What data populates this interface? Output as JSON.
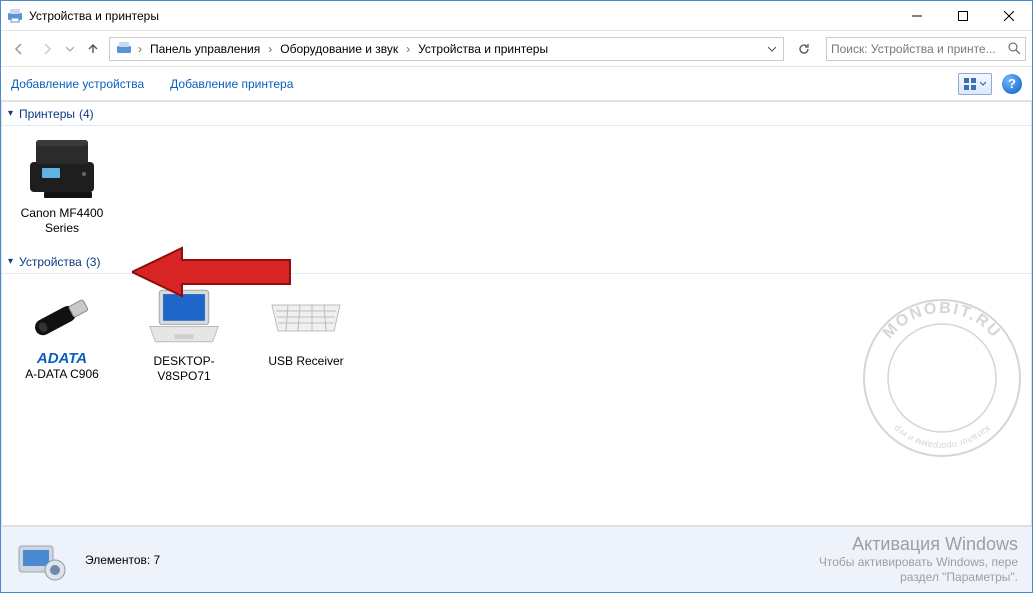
{
  "window": {
    "title": "Устройства и принтеры"
  },
  "nav": {
    "crumbs": [
      "Панель управления",
      "Оборудование и звук",
      "Устройства и принтеры"
    ]
  },
  "search": {
    "placeholder": "Поиск: Устройства и принте..."
  },
  "commands": {
    "add_device": "Добавление устройства",
    "add_printer": "Добавление принтера"
  },
  "groups": [
    {
      "name": "Принтеры",
      "count": "(4)",
      "items": [
        {
          "label": "Canon MF4400 Series",
          "icon": "printer"
        }
      ]
    },
    {
      "name": "Устройства",
      "count": "(3)",
      "items": [
        {
          "label": "A-DATA C906",
          "icon": "usb",
          "brand": "ADATA"
        },
        {
          "label": "DESKTOP-V8SPO71",
          "icon": "laptop"
        },
        {
          "label": "USB Receiver",
          "icon": "keyboard"
        }
      ]
    }
  ],
  "details": {
    "summary": "Элементов: 7"
  },
  "watermark": {
    "title": "Активация Windows",
    "sub1": "Чтобы активировать Windows, пере",
    "sub2": "раздел \"Параметры\"."
  },
  "stamp": {
    "line1": "MONOBIT.RU",
    "line2": "Каталог программ и игр"
  },
  "help_glyph": "?"
}
